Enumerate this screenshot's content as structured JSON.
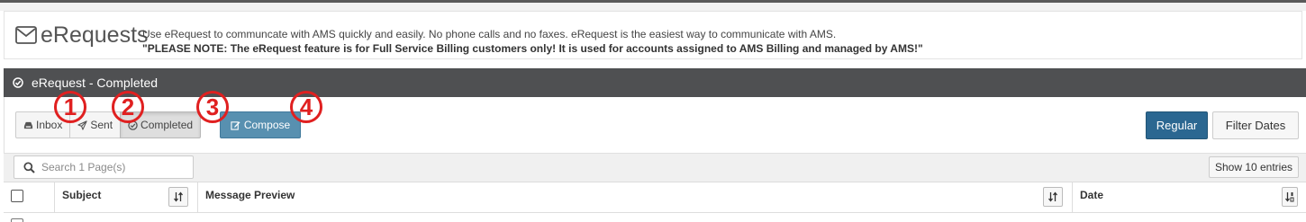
{
  "header": {
    "title": "eRequests",
    "description": "Use eRequest to communcate with AMS quickly and easily. No phone calls and no faxes. eRequest is the easiest way to communicate with AMS.",
    "note": "\"PLEASE NOTE: The eRequest feature is for Full Service Billing customers only! It is used for accounts assigned to AMS Billing and managed by AMS!\""
  },
  "section": {
    "title": "eRequest - Completed"
  },
  "tabs": [
    {
      "label": "Inbox",
      "icon": "inbox-icon",
      "active": false
    },
    {
      "label": "Sent",
      "icon": "paper-plane-icon",
      "active": false
    },
    {
      "label": "Completed",
      "icon": "check-circle-icon",
      "active": true
    }
  ],
  "compose": {
    "label": "Compose",
    "icon": "edit-icon"
  },
  "callouts": [
    "1",
    "2",
    "3",
    "4"
  ],
  "view_buttons": {
    "regular": "Regular",
    "filter_dates": "Filter Dates"
  },
  "search": {
    "placeholder": "Search 1 Page(s)",
    "value": ""
  },
  "show_entries": "Show 10 entries",
  "table": {
    "columns": [
      "Subject",
      "Message Preview",
      "Date"
    ]
  },
  "colors": {
    "section_bar": "#4f5052",
    "compose": "#5890b0",
    "regular": "#2b6791",
    "callout": "#e02020"
  }
}
